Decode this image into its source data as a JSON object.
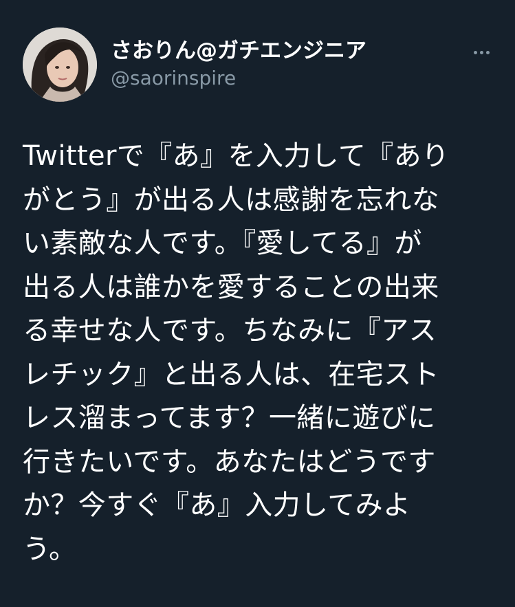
{
  "user": {
    "display_name": "さおりん@ガチエンジニア",
    "username": "@saorinspire"
  },
  "tweet": {
    "lines": [
      "Twitterで『あ』を入力して『あり",
      "がとう』が出る人は感謝を忘れな",
      "い素敵な人です。『愛してる』が",
      "出る人は誰かを愛することの出来",
      "る幸せな人です。ちなみに『アス",
      "レチック』と出る人は、在宅スト",
      "レス溜まってます？一緒に遊びに",
      "行きたいです。あなたはどうです",
      "か？今すぐ『あ』入力してみよ",
      "う。"
    ]
  },
  "icons": {
    "more": "more-dots-icon",
    "avatar": "profile-avatar"
  },
  "colors": {
    "background": "#15202b",
    "text_primary": "#ffffff",
    "text_secondary": "#8899a6"
  }
}
